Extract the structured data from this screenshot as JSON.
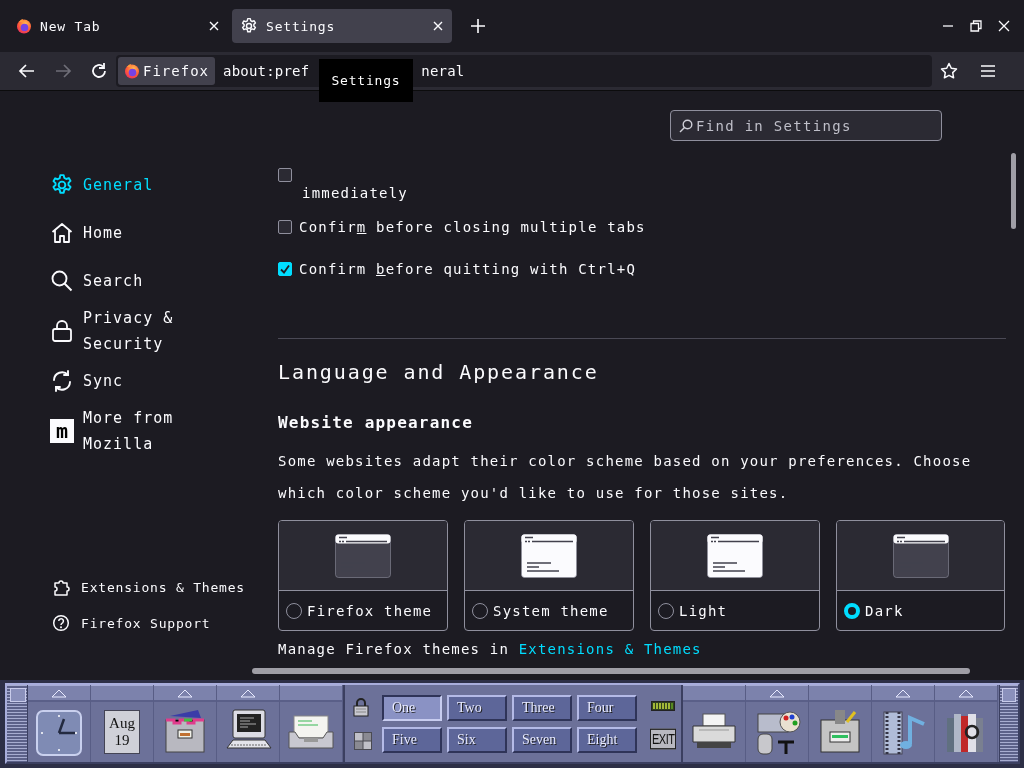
{
  "tabs": [
    {
      "title": "New Tab",
      "selected": false
    },
    {
      "title": "Settings",
      "selected": true
    }
  ],
  "toolbar": {
    "identity": "Firefox",
    "url_parts": [
      "about:pref",
      "neral"
    ],
    "tooltip": "Settings",
    "forward_disabled": true
  },
  "search": {
    "placeholder": "Find in Settings"
  },
  "sidebar": {
    "items": [
      {
        "label": "General",
        "selected": true
      },
      {
        "label": "Home",
        "selected": false
      },
      {
        "label": "Search",
        "selected": false
      },
      {
        "label": "Privacy & Security",
        "selected": false
      },
      {
        "label": "Sync",
        "selected": false
      },
      {
        "label": "More from Mozilla",
        "logo_text": "m",
        "selected": false
      }
    ],
    "footer": [
      {
        "label": "Extensions & Themes"
      },
      {
        "label": "Firefox Support"
      }
    ]
  },
  "options": [
    {
      "kind": "clipped",
      "label_parts": [
        "immediately"
      ],
      "checked": false
    },
    {
      "kind": "full",
      "label_parts": [
        "Confir",
        "m",
        " before closing multiple tabs"
      ],
      "checked": false
    },
    {
      "kind": "full",
      "label_parts": [
        "Confirm ",
        "b",
        "efore quitting with Ctrl+Q"
      ],
      "checked": true
    }
  ],
  "section": {
    "title": "Language and Appearance",
    "subtitle": "Website appearance",
    "description": "Some websites adapt their color scheme based on your preferences. Choose which color scheme you'd like to use for those sites.",
    "themes": [
      {
        "label": "Firefox theme",
        "kind": "dark",
        "selected": false
      },
      {
        "label": "System theme",
        "kind": "light",
        "selected": false
      },
      {
        "label": "Light",
        "kind": "light",
        "selected": false
      },
      {
        "label": "Dark",
        "kind": "dark",
        "selected": true
      }
    ],
    "manage_text": "Manage Firefox themes in",
    "manage_link": "Extensions & Themes"
  },
  "panel": {
    "left": [
      {
        "kind": "clock",
        "has_menu": true
      },
      {
        "kind": "calendar",
        "month": "Aug",
        "day": "19",
        "has_menu": false
      },
      {
        "kind": "files",
        "has_menu": true
      },
      {
        "kind": "terminal",
        "has_menu": true
      },
      {
        "kind": "mail",
        "has_menu": false
      }
    ],
    "workspaces": [
      {
        "label": "One",
        "selected": true
      },
      {
        "label": "Two",
        "selected": false
      },
      {
        "label": "Three",
        "selected": false
      },
      {
        "label": "Four",
        "selected": false
      },
      {
        "label": "Five",
        "selected": false
      },
      {
        "label": "Six",
        "selected": false
      },
      {
        "label": "Seven",
        "selected": false
      },
      {
        "label": "Eight",
        "selected": false
      }
    ],
    "exit": "EXIT",
    "right": [
      {
        "kind": "printer",
        "has_menu": false
      },
      {
        "kind": "style",
        "has_menu": true
      },
      {
        "kind": "apps",
        "has_menu": false
      },
      {
        "kind": "media",
        "has_menu": true
      },
      {
        "kind": "help",
        "has_menu": true
      }
    ]
  }
}
